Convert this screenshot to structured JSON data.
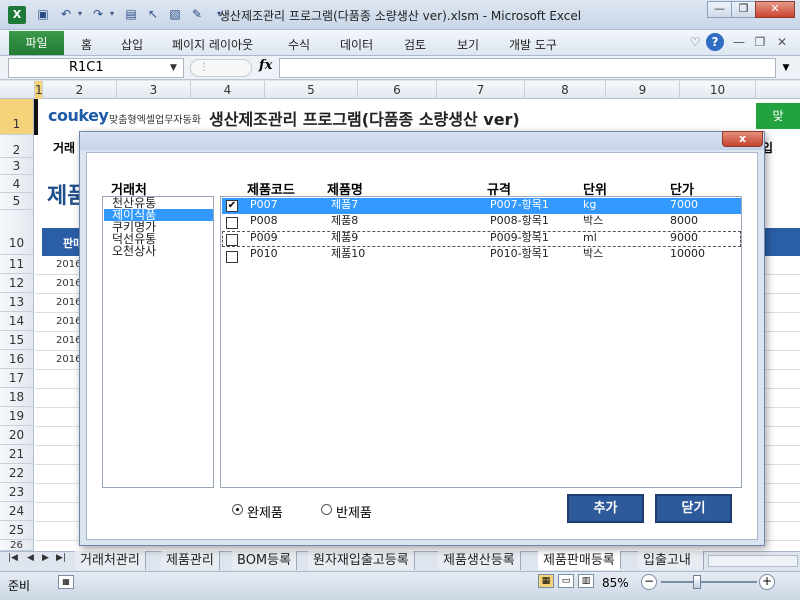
{
  "window": {
    "title": "생산제조관리 프로그램(다품종 소량생산 ver).xlsm  -  Microsoft Excel",
    "excel_icon": "X",
    "min_icon": "minimize-icon",
    "restore_icon": "restore-icon",
    "close_icon": "close-icon"
  },
  "ribbon": {
    "file": "파일",
    "tabs": [
      "홈",
      "삽입",
      "페이지 레이아웃",
      "수식",
      "데이터",
      "검토",
      "보기",
      "개발 도구"
    ]
  },
  "formula_bar": {
    "name_box": "R1C1",
    "fx": "fx",
    "value": ""
  },
  "grid": {
    "columns": [
      "1",
      "2",
      "3",
      "4",
      "5",
      "6",
      "7",
      "8",
      "9",
      "10"
    ],
    "rows": [
      "1",
      "2",
      "3",
      "4",
      "5",
      "10",
      "11",
      "12",
      "13",
      "14",
      "15",
      "16",
      "17",
      "18",
      "19",
      "20",
      "21",
      "22",
      "23",
      "24",
      "25",
      "26"
    ],
    "logo": "coukey",
    "logo_sub": "맞춤형엑셀업무자동화",
    "title": "생산제조관리 프로그램(다품종 소량생산 ver)",
    "green_button": "맞",
    "nav_first": "거래",
    "nav_last": "입",
    "big_title": "제품",
    "table_header": "판매",
    "date_cells": [
      "2016",
      "2016",
      "2016",
      "2016",
      "2016",
      "2016"
    ]
  },
  "sheet_tabs": [
    "거래처관리",
    "제품관리",
    "BOM등록",
    "원자재입출고등록",
    "제품생산등록",
    "제품판매등록",
    "입출고내"
  ],
  "active_sheet_tab": "제품판매등록",
  "status": {
    "ready": "준비",
    "zoom": "85%",
    "zoom_fraction": 0.38
  },
  "dialog": {
    "close_label": "x",
    "client_label": "거래처",
    "clients": [
      "천산유통",
      "제이식품",
      "쿠키명가",
      "덕선유통",
      "오천상사"
    ],
    "selected_client": "제이식품",
    "product_headers": {
      "code": "제품코드",
      "name": "제품명",
      "spec": "규격",
      "unit": "단위",
      "price": "단가"
    },
    "products": [
      {
        "code": "P007",
        "name": "제품7",
        "spec": "P007-항목1",
        "unit": "kg",
        "price": "7000",
        "checked": true
      },
      {
        "code": "P008",
        "name": "제품8",
        "spec": "P008-항목1",
        "unit": "박스",
        "price": "8000",
        "checked": false
      },
      {
        "code": "P009",
        "name": "제품9",
        "spec": "P009-항목1",
        "unit": "ml",
        "price": "9000",
        "checked": false
      },
      {
        "code": "P010",
        "name": "제품10",
        "spec": "P010-항목1",
        "unit": "박스",
        "price": "10000",
        "checked": false
      }
    ],
    "radio_finished": "완제품",
    "radio_semi": "반제품",
    "selected_radio": "완제품",
    "add_button": "추가",
    "close_button": "닫기"
  }
}
